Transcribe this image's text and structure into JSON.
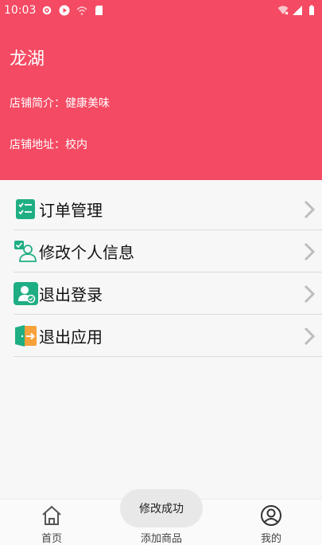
{
  "status_bar": {
    "time": "10:03",
    "left_icons": [
      "gear-icon",
      "play-icon",
      "wifi-off-icon",
      "sd-card-icon"
    ],
    "right_icons": [
      "wifi-icon",
      "signal-icon",
      "battery-icon"
    ]
  },
  "shop": {
    "name": "龙湖",
    "intro": "店铺简介：健康美味",
    "address": "店铺地址：校内"
  },
  "colors": {
    "accent": "#f44a63",
    "icon_green": "#1fae84",
    "icon_orange": "#f7a13b"
  },
  "menu": {
    "items": [
      {
        "label": "订单管理",
        "icon": "order-list-icon"
      },
      {
        "label": "修改个人信息",
        "icon": "edit-profile-icon"
      },
      {
        "label": "退出登录",
        "icon": "logout-user-icon"
      },
      {
        "label": "退出应用",
        "icon": "exit-app-icon"
      }
    ]
  },
  "bottom_nav": {
    "items": [
      {
        "label": "首页",
        "icon": "home-icon"
      },
      {
        "label": "添加商品",
        "icon": "add-product-icon"
      },
      {
        "label": "我的",
        "icon": "user-circle-icon"
      }
    ]
  },
  "toast": {
    "text": "修改成功"
  }
}
